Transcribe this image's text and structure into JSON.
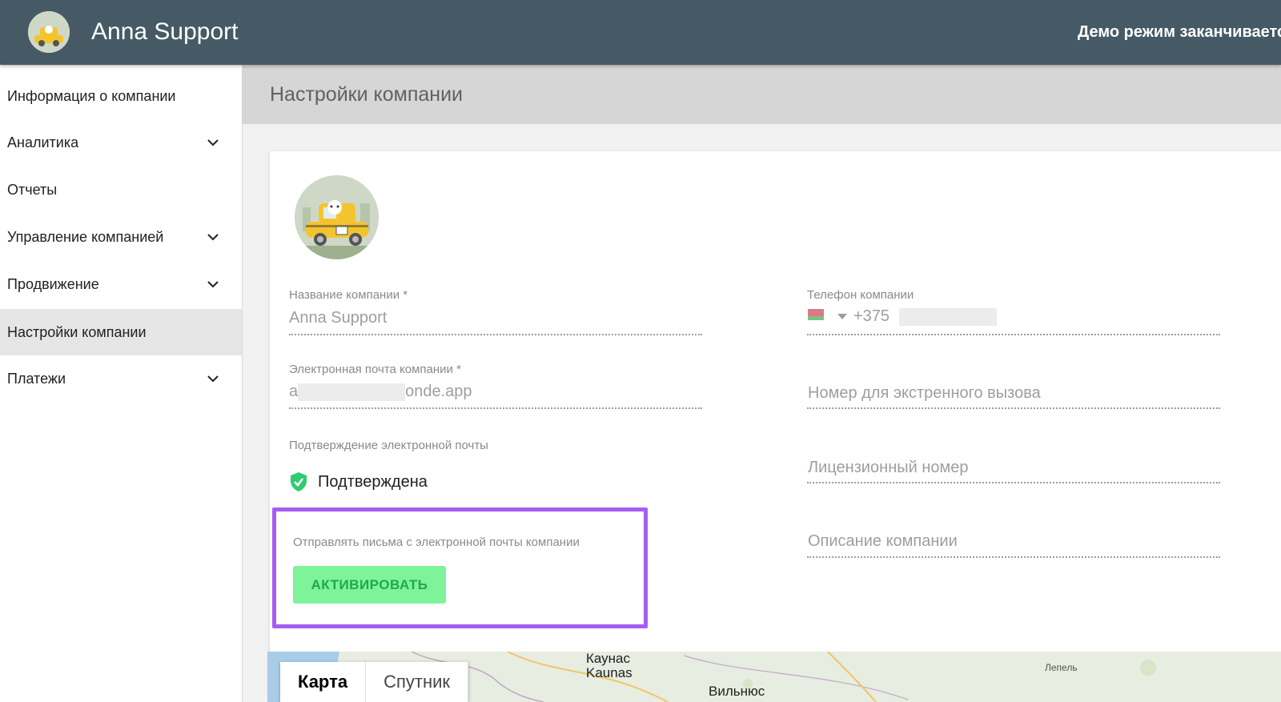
{
  "header": {
    "app_title": "Anna Support",
    "demo_notice": "Демо режим заканчивается"
  },
  "sidebar": {
    "items": [
      {
        "label": "Информация о компании",
        "has_chevron": false
      },
      {
        "label": "Аналитика",
        "has_chevron": true
      },
      {
        "label": "Отчеты",
        "has_chevron": false
      },
      {
        "label": "Управление компанией",
        "has_chevron": true
      },
      {
        "label": "Продвижение",
        "has_chevron": true
      },
      {
        "label": "Настройки компании",
        "has_chevron": false,
        "active": true
      },
      {
        "label": "Платежи",
        "has_chevron": true
      }
    ]
  },
  "page": {
    "title": "Настройки компании"
  },
  "form": {
    "company_name": {
      "label": "Название компании *",
      "value": "Anna Support"
    },
    "company_email": {
      "label": "Электронная почта компании *",
      "value_prefix": "a",
      "value_suffix": "onde.app"
    },
    "email_confirmation": {
      "label": "Подтверждение электронной почты",
      "status": "Подтверждена"
    },
    "send_from_company_email": {
      "label": "Отправлять письма с электронной почты компании",
      "button": "АКТИВИРОВАТЬ"
    },
    "company_phone": {
      "label": "Телефон компании",
      "country_code": "+375"
    },
    "emergency_number": {
      "placeholder": "Номер для экстренного вызова"
    },
    "license_number": {
      "placeholder": "Лицензионный номер"
    },
    "company_description": {
      "placeholder": "Описание компании"
    }
  },
  "map": {
    "tabs": [
      "Карта",
      "Спутник"
    ],
    "places": [
      "Каунас",
      "Kaunas",
      "Вильнюс",
      "Лепель"
    ]
  },
  "colors": {
    "header_bg": "#455a64",
    "highlight_border": "#a45ef2",
    "button_bg": "#7ef39a",
    "button_text": "#21a84a",
    "verified_green": "#2ecc71"
  }
}
